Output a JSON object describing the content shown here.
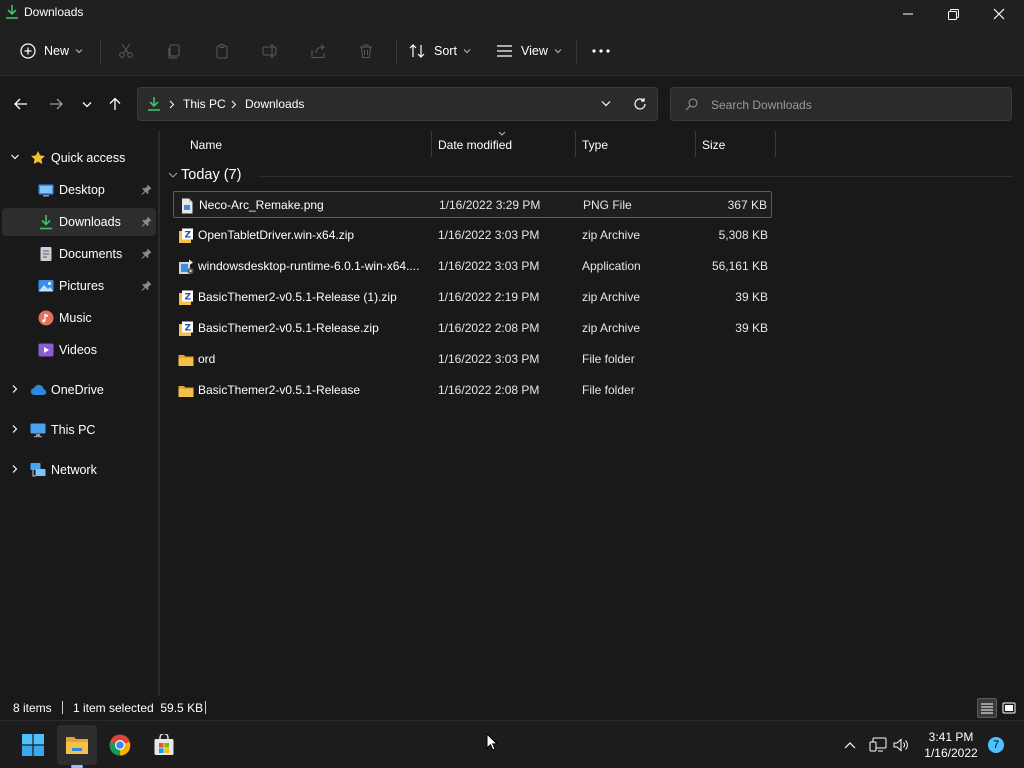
{
  "window": {
    "title": "Downloads"
  },
  "toolbar": {
    "new_label": "New",
    "sort_label": "Sort",
    "view_label": "View"
  },
  "address": {
    "crumbs": [
      "This PC",
      "Downloads"
    ]
  },
  "search": {
    "placeholder": "Search Downloads"
  },
  "sidebar": {
    "items": [
      {
        "label": "Quick access",
        "icon": "star-icon"
      },
      {
        "label": "Desktop",
        "icon": "desktop-icon",
        "pinned": true
      },
      {
        "label": "Downloads",
        "icon": "download-icon",
        "pinned": true,
        "selected": true
      },
      {
        "label": "Documents",
        "icon": "document-icon",
        "pinned": true
      },
      {
        "label": "Pictures",
        "icon": "pictures-icon",
        "pinned": true
      },
      {
        "label": "Music",
        "icon": "music-icon"
      },
      {
        "label": "Videos",
        "icon": "videos-icon"
      },
      {
        "label": "OneDrive",
        "icon": "cloud-icon"
      },
      {
        "label": "This PC",
        "icon": "computer-icon"
      },
      {
        "label": "Network",
        "icon": "network-icon"
      }
    ]
  },
  "columns": {
    "name": "Name",
    "date": "Date modified",
    "type": "Type",
    "size": "Size"
  },
  "group": {
    "label": "Today (7)"
  },
  "files": [
    {
      "name": "Neco-Arc_Remake.png",
      "date": "1/16/2022 3:29 PM",
      "type": "PNG File",
      "size": "367 KB",
      "icon": "image-file-icon",
      "selected": true
    },
    {
      "name": "OpenTabletDriver.win-x64.zip",
      "date": "1/16/2022 3:03 PM",
      "type": "zip Archive",
      "size": "5,308 KB",
      "icon": "zip-file-icon"
    },
    {
      "name": "windowsdesktop-runtime-6.0.1-win-x64....",
      "date": "1/16/2022 3:03 PM",
      "type": "Application",
      "size": "56,161 KB",
      "icon": "installer-icon"
    },
    {
      "name": "BasicThemer2-v0.5.1-Release (1).zip",
      "date": "1/16/2022 2:19 PM",
      "type": "zip Archive",
      "size": "39 KB",
      "icon": "zip-file-icon"
    },
    {
      "name": "BasicThemer2-v0.5.1-Release.zip",
      "date": "1/16/2022 2:08 PM",
      "type": "zip Archive",
      "size": "39 KB",
      "icon": "zip-file-icon"
    },
    {
      "name": "ord",
      "date": "1/16/2022 3:03 PM",
      "type": "File folder",
      "size": "",
      "icon": "folder-icon"
    },
    {
      "name": "BasicThemer2-v0.5.1-Release",
      "date": "1/16/2022 2:08 PM",
      "type": "File folder",
      "size": "",
      "icon": "folder-icon"
    }
  ],
  "status": {
    "count": "8 items",
    "selection": "1 item selected  59.5 KB"
  },
  "taskbar": {
    "time": "3:41 PM",
    "date": "1/16/2022",
    "notifications": "7"
  },
  "colors": {
    "accent": "#4cc2ff",
    "folder": "#f5c04a",
    "download_green": "#3fbf6f"
  }
}
